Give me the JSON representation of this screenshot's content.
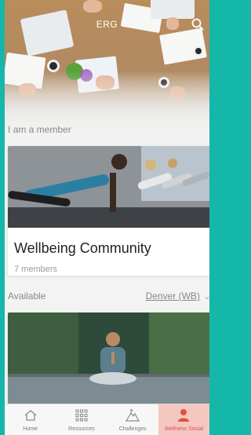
{
  "app": {
    "title": "ERG"
  },
  "sections": {
    "member_label": "I am a member",
    "available_label": "Available"
  },
  "member_card": {
    "title": "Wellbeing Community",
    "members": "7 members"
  },
  "location_filter": {
    "selected": "Denver (WB)"
  },
  "tabs": [
    {
      "label": "Home",
      "icon": "home-icon"
    },
    {
      "label": "Resources",
      "icon": "grid-icon"
    },
    {
      "label": "Challenges",
      "icon": "mountain-icon"
    },
    {
      "label": "Wellness Social",
      "icon": "person-icon",
      "active": true
    }
  ],
  "colors": {
    "frame": "#15b7a9",
    "active_tab_bg": "#f4c7c0",
    "active_tab_text": "#d9534f"
  }
}
